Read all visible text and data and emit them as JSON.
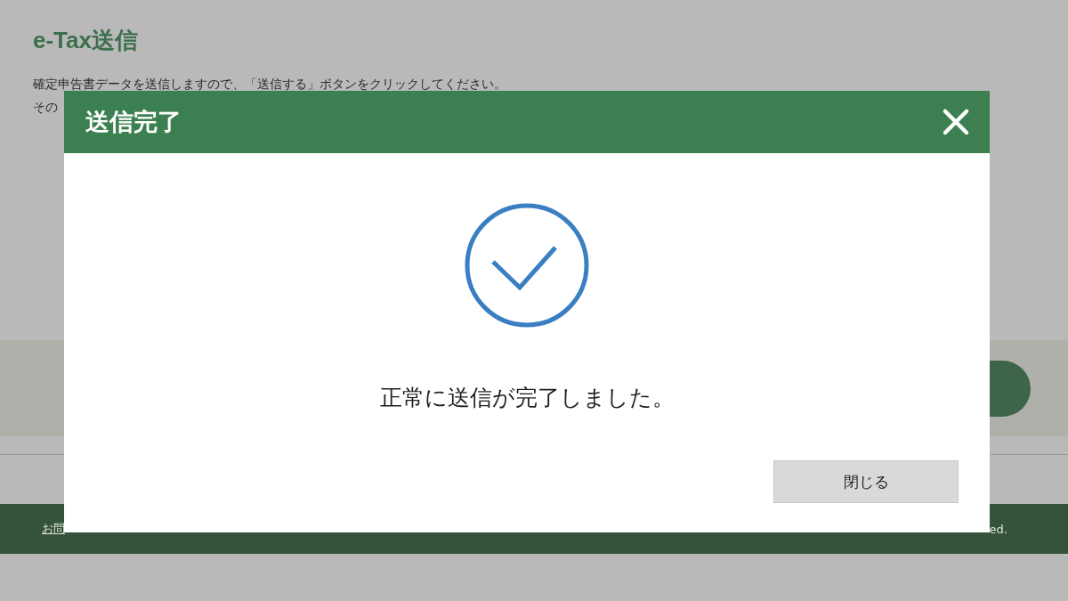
{
  "page": {
    "title": "e-Tax送信",
    "lines": [
      "確定申告書データを送信しますので、「送信する」ボタンをクリックしてください。",
      "その"
    ],
    "footer": {
      "link": "お問",
      "copyright": "ed."
    }
  },
  "dialog": {
    "title": "送信完了",
    "message": "正常に送信が完了しました。",
    "button": "閉じる"
  }
}
